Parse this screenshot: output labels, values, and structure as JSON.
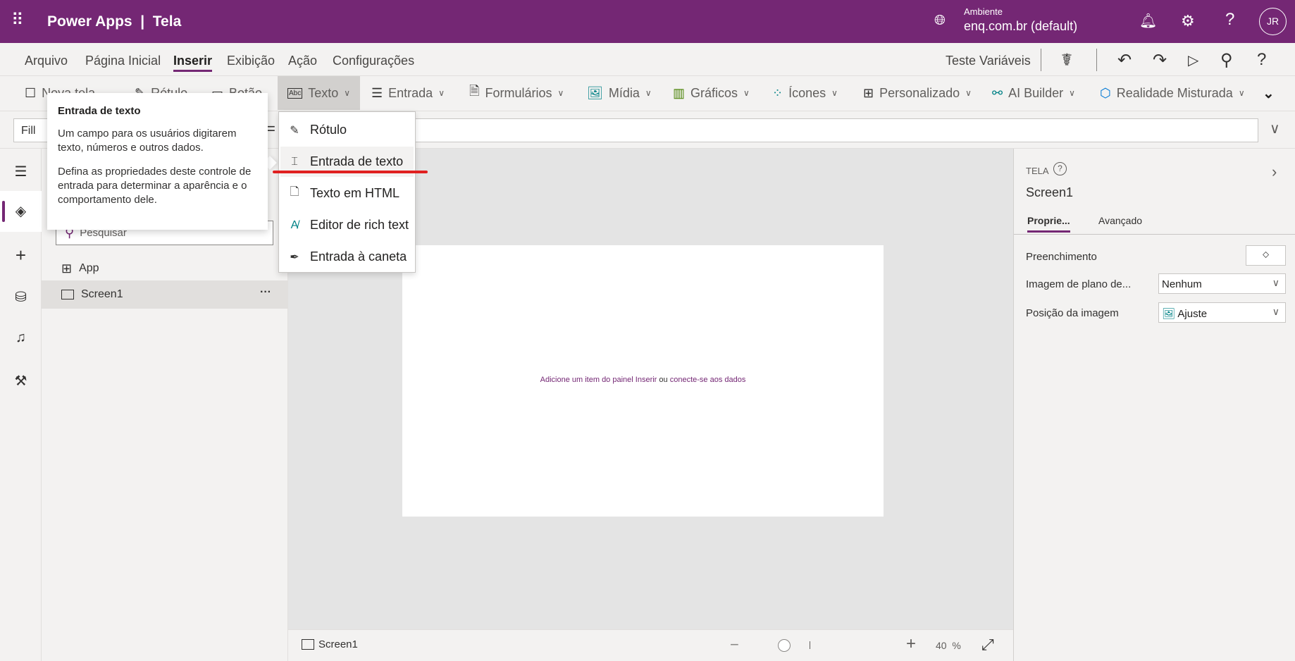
{
  "header": {
    "title": "Power Apps  |  Tela",
    "environment_label": "Ambiente",
    "environment_value": "enq.com.br (default)",
    "avatar_initials": "JR",
    "brand_color": "#742774"
  },
  "menu": {
    "items": [
      "Arquivo",
      "Página Inicial",
      "Inserir",
      "Exibição",
      "Ação",
      "Configurações"
    ],
    "active": "Inserir",
    "app_name": "Teste Variáveis"
  },
  "toolbar": {
    "items": [
      {
        "label": "Nova tela",
        "icon": "new-screen-icon"
      },
      {
        "label": "Rótulo",
        "icon": "label-icon"
      },
      {
        "label": "Botão",
        "icon": "button-icon"
      },
      {
        "label": "Texto",
        "icon": "text-icon"
      },
      {
        "label": "Entrada",
        "icon": "input-icon"
      },
      {
        "label": "Formulários",
        "icon": "forms-icon"
      },
      {
        "label": "Mídia",
        "icon": "media-icon"
      },
      {
        "label": "Gráficos",
        "icon": "charts-icon"
      },
      {
        "label": "Ícones",
        "icon": "icons-icon"
      },
      {
        "label": "Personalizado",
        "icon": "custom-icon"
      },
      {
        "label": "AI Builder",
        "icon": "ai-builder-icon"
      },
      {
        "label": "Realidade Misturada",
        "icon": "mixed-reality-icon"
      }
    ]
  },
  "formula": {
    "property": "Fill",
    "equals": "=",
    "value": ""
  },
  "tooltip": {
    "title": "Entrada de texto",
    "p1": "Um campo para os usuários digitarem texto, números e outros dados.",
    "p2": "Defina as propriedades deste controle de entrada para determinar a aparência e o comportamento dele."
  },
  "text_menu": {
    "items": [
      "Rótulo",
      "Entrada de texto",
      "Texto em HTML",
      "Editor de rich text",
      "Entrada à caneta"
    ],
    "highlighted": "Entrada de texto",
    "annotation_color": "#e02020"
  },
  "tree": {
    "search_placeholder": "Pesquisar",
    "items": [
      "App",
      "Screen1"
    ],
    "selected": "Screen1",
    "more": "···"
  },
  "canvas": {
    "hint_a": "Adicione um item do painel Inserir",
    "hint_or": "ou",
    "hint_b": "conecte-se aos dados",
    "screen_name": "Screen1",
    "zoom": "40",
    "zoom_unit": "%"
  },
  "properties": {
    "type": "TELA",
    "name": "Screen1",
    "tabs": [
      "Proprie...",
      "Avançado"
    ],
    "active_tab": "Proprie...",
    "rows": [
      {
        "label": "Preenchimento"
      },
      {
        "label": "Imagem de plano de...",
        "value": "Nenhum"
      },
      {
        "label": "Posição da imagem",
        "value": "Ajuste"
      }
    ]
  }
}
